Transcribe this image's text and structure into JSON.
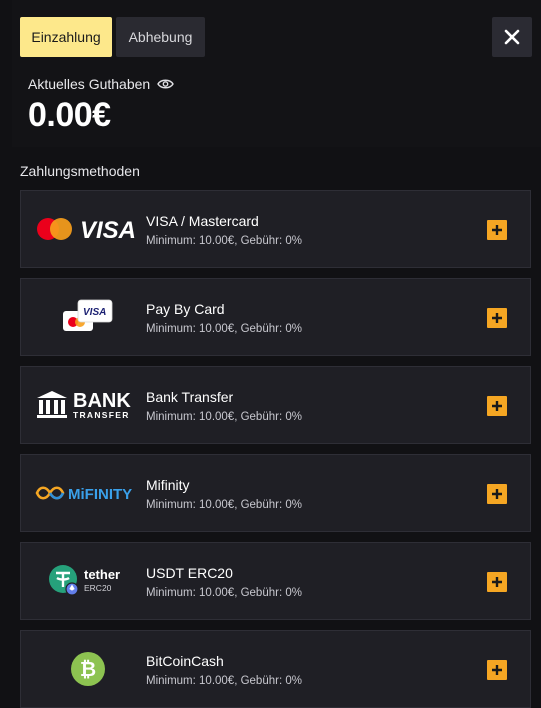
{
  "tabs": {
    "deposit": "Einzahlung",
    "withdraw": "Abhebung"
  },
  "balance": {
    "label": "Aktuelles Guthaben",
    "value": "0.00€"
  },
  "section": {
    "title": "Zahlungsmethoden"
  },
  "methods": [
    {
      "name": "VISA / Mastercard",
      "info": "Minimum: 10.00€, Gebühr: 0%",
      "logo_text": "VISA"
    },
    {
      "name": "Pay By Card",
      "info": "Minimum: 10.00€, Gebühr: 0%",
      "logo_text": "VISA"
    },
    {
      "name": "Bank Transfer",
      "info": "Minimum: 10.00€, Gebühr: 0%",
      "logo_text": "BANK",
      "logo_sub": "TRANSFER"
    },
    {
      "name": "Mifinity",
      "info": "Minimum: 10.00€, Gebühr: 0%",
      "logo_text": "MiFINITY"
    },
    {
      "name": "USDT ERC20",
      "info": "Minimum: 10.00€, Gebühr: 0%",
      "logo_text": "tether",
      "logo_sub": "ERC20"
    },
    {
      "name": "BitCoinCash",
      "info": "Minimum: 10.00€, Gebühr: 0%"
    }
  ],
  "colors": {
    "accent": "#fde88b",
    "plus": "#f5a623",
    "panel": "#1f1f25",
    "background": "#111114"
  }
}
